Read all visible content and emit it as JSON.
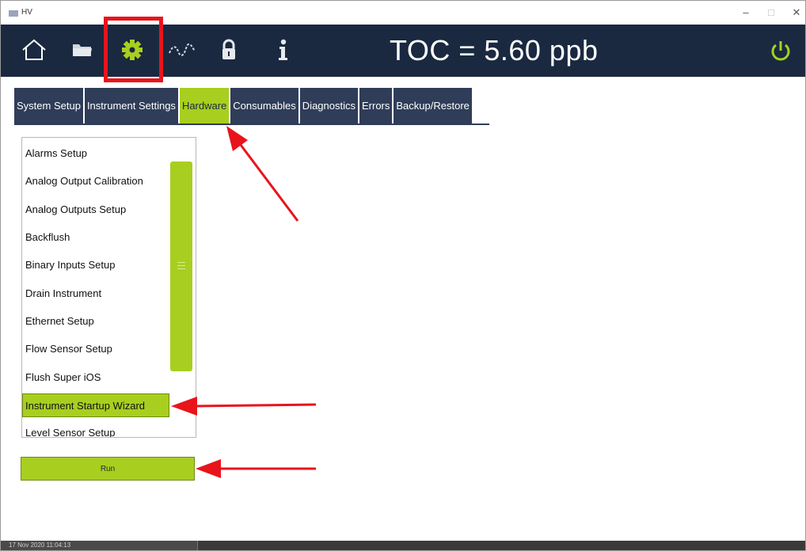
{
  "window": {
    "title": "HV",
    "minimize": "–",
    "maximize": "□",
    "close": "✕"
  },
  "header": {
    "toc_text": "TOC = 5.60 ppb",
    "icons": [
      "home-icon",
      "folder-icon",
      "gear-icon",
      "trend-icon",
      "lock-icon",
      "info-icon",
      "power-icon"
    ]
  },
  "tabs": [
    {
      "label": "System Setup"
    },
    {
      "label": "Instrument Settings"
    },
    {
      "label": "Hardware",
      "active": true
    },
    {
      "label": "Consumables"
    },
    {
      "label": "Diagnostics"
    },
    {
      "label": "Errors"
    },
    {
      "label": "Backup/Restore"
    }
  ],
  "list": {
    "items": [
      "Alarms Setup",
      "Analog Output Calibration",
      "Analog Outputs Setup",
      "Backflush",
      "Binary Inputs Setup",
      "Drain Instrument",
      "Ethernet Setup",
      "Flow Sensor Setup",
      "Flush Super iOS",
      "Instrument Startup Wizard",
      "Level Sensor Setup"
    ],
    "selected": "Instrument Startup Wizard"
  },
  "run_label": "Run",
  "status": {
    "datetime": "17 Nov 2020 11:04:13"
  },
  "colors": {
    "header": "#1a2940",
    "tab": "#2f3d59",
    "accent": "#a8cf1f",
    "annotation": "#e8141c"
  }
}
